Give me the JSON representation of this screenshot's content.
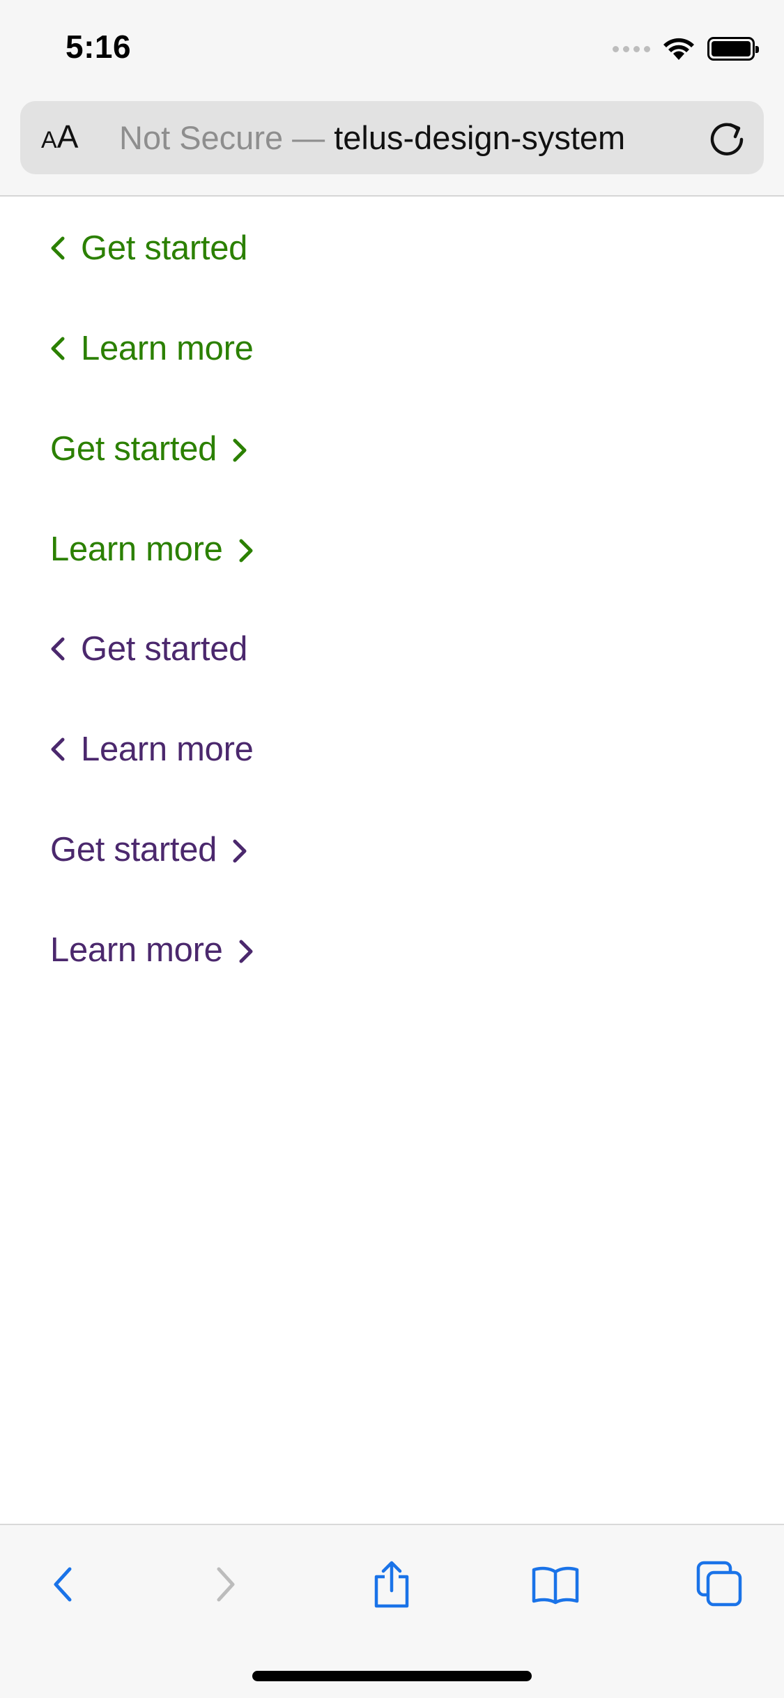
{
  "status_bar": {
    "time": "5:16"
  },
  "url_bar": {
    "aa_small": "A",
    "aa_big": "A",
    "security_label": "Not Secure — ",
    "host": "telus-design-system"
  },
  "links": [
    {
      "label": "Get started",
      "chevron": "left",
      "color": "#2b8000"
    },
    {
      "label": "Learn more",
      "chevron": "left",
      "color": "#2b8000"
    },
    {
      "label": "Get started",
      "chevron": "right",
      "color": "#2b8000"
    },
    {
      "label": "Learn more",
      "chevron": "right",
      "color": "#2b8000"
    },
    {
      "label": "Get started",
      "chevron": "left",
      "color": "#4b286d"
    },
    {
      "label": "Learn more",
      "chevron": "left",
      "color": "#4b286d"
    },
    {
      "label": "Get started",
      "chevron": "right",
      "color": "#4b286d"
    },
    {
      "label": "Learn more",
      "chevron": "right",
      "color": "#4b286d"
    }
  ],
  "toolbar": {
    "icons": [
      "back-icon",
      "forward-icon",
      "share-icon",
      "bookmarks-icon",
      "tabs-icon"
    ],
    "accent": "#1a73e8"
  }
}
